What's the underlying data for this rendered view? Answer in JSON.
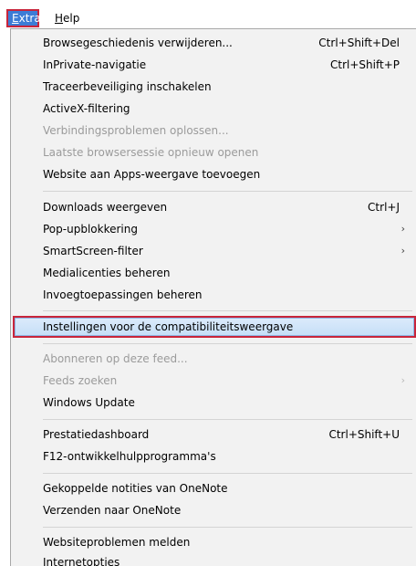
{
  "menubar": {
    "extra_label": "Extra",
    "extra_rest": "xtra",
    "extra_first": "E",
    "help_first": "H",
    "help_rest": "elp"
  },
  "menu": {
    "items": [
      {
        "label": "Browsegeschiedenis verwijderen...",
        "shortcut": "Ctrl+Shift+Del",
        "enabled": true
      },
      {
        "label": "InPrivate-navigatie",
        "shortcut": "Ctrl+Shift+P",
        "enabled": true
      },
      {
        "label": "Traceerbeveiliging inschakelen",
        "shortcut": "",
        "enabled": true
      },
      {
        "label": "ActiveX-filtering",
        "shortcut": "",
        "enabled": true
      },
      {
        "label": "Verbindingsproblemen oplossen...",
        "shortcut": "",
        "enabled": false
      },
      {
        "label": "Laatste browsersessie opnieuw openen",
        "shortcut": "",
        "enabled": false
      },
      {
        "label": "Website aan Apps-weergave toevoegen",
        "shortcut": "",
        "enabled": true
      },
      {
        "label": "Downloads weergeven",
        "shortcut": "Ctrl+J",
        "enabled": true
      },
      {
        "label": "Pop-upblokkering",
        "shortcut": "",
        "submenu": true,
        "enabled": true
      },
      {
        "label": "SmartScreen-filter",
        "shortcut": "",
        "submenu": true,
        "enabled": true
      },
      {
        "label": "Medialicenties beheren",
        "shortcut": "",
        "enabled": true
      },
      {
        "label": "Invoegtoepassingen beheren",
        "shortcut": "",
        "enabled": true
      },
      {
        "label": "Instellingen voor de compatibiliteitsweergave",
        "shortcut": "",
        "enabled": true,
        "highlighted": true
      },
      {
        "label": "Abonneren op deze feed...",
        "shortcut": "",
        "enabled": false
      },
      {
        "label": "Feeds zoeken",
        "shortcut": "",
        "submenu": true,
        "enabled": false
      },
      {
        "label": "Windows Update",
        "shortcut": "",
        "enabled": true
      },
      {
        "label": "Prestatiedashboard",
        "shortcut": "Ctrl+Shift+U",
        "enabled": true
      },
      {
        "label": "F12-ontwikkelhulpprogramma's",
        "shortcut": "",
        "enabled": true
      },
      {
        "label": "Gekoppelde notities van OneNote",
        "shortcut": "",
        "enabled": true
      },
      {
        "label": "Verzenden naar OneNote",
        "shortcut": "",
        "enabled": true
      },
      {
        "label": "Websiteproblemen melden",
        "shortcut": "",
        "enabled": true
      },
      {
        "label": "Internetopties",
        "shortcut": "",
        "enabled": true
      }
    ],
    "submenu_arrow": "›",
    "highlight_border_color": "#c8253b",
    "highlight_fill_color": "#cde4fa"
  }
}
